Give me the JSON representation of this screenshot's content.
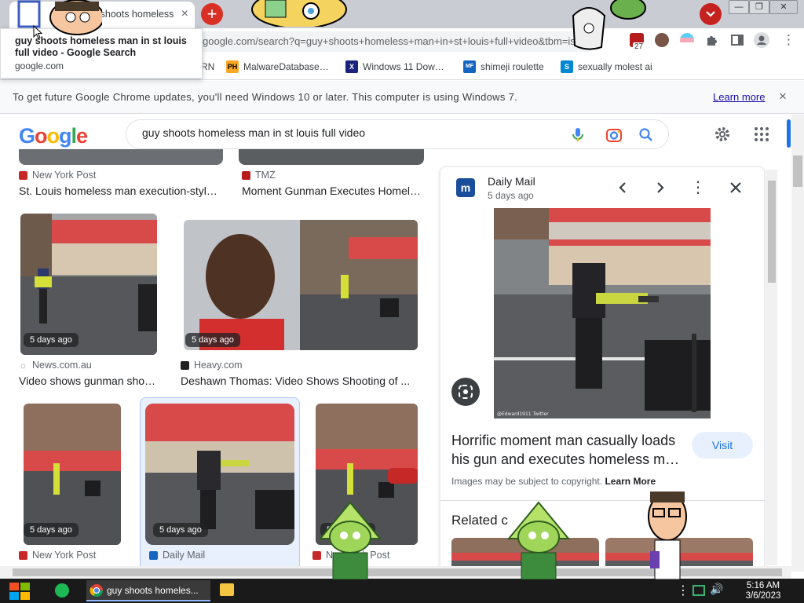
{
  "browser": {
    "tab_title": "guy shoots homeless man in st louis full video - Google Search",
    "url": "google.com/search?q=guy+shoots+homeless+man+in+st+louis+full+video&tbm=isch&so…",
    "new_tab_label": "+",
    "tab_close": "×",
    "extension_badge": "27",
    "tooltip": {
      "title": "guy shoots homeless man in st louis full video - Google Search",
      "domain": "google.com"
    },
    "bookmarks": [
      {
        "label": "RN"
      },
      {
        "label": "MalwareDatabase…",
        "icon": "PH"
      },
      {
        "label": "Windows 11 Dow…",
        "icon": "X"
      },
      {
        "label": "shimeji roulette",
        "icon": "MF"
      },
      {
        "label": "sexually molest ai",
        "icon": "S"
      }
    ],
    "infobar": {
      "message": "To get future Google Chrome updates, you'll need Windows 10 or later. This computer is using Windows 7.",
      "link": "Learn more",
      "close": "×"
    }
  },
  "google": {
    "logo": [
      "G",
      "o",
      "o",
      "g",
      "l",
      "e"
    ],
    "logo_colors": [
      "#4285F4",
      "#EA4335",
      "#FBBC05",
      "#4285F4",
      "#34A853",
      "#EA4335"
    ],
    "query": "guy shoots homeless man in st louis full video"
  },
  "results": [
    {
      "source": "New York Post",
      "caption": "St. Louis homeless man execution-styl…",
      "fav": "#c62828"
    },
    {
      "source": "TMZ",
      "caption": "Moment Gunman Executes Homel…",
      "fav": "#b71c1c"
    },
    {
      "source": "News.com.au",
      "caption": "Video shows gunman sho…",
      "badge": "5 days ago",
      "fav": "#9e9e9e"
    },
    {
      "source": "Heavy.com",
      "caption": "Deshawn Thomas: Video Shows Shooting of ...",
      "badge": "5 days ago",
      "fav": "#212121"
    },
    {
      "source": "New York Post",
      "badge": "5 days ago",
      "fav": "#c62828"
    },
    {
      "source": "Daily Mail",
      "badge": "5 days ago",
      "fav": "#1565c0"
    },
    {
      "source": "New York Post",
      "badge": "5 days ago",
      "fav": "#c62828"
    }
  ],
  "preview": {
    "source": "Daily Mail",
    "date": "5 days ago",
    "title": "Horrific moment man casually loads his gun and executes homeless m…",
    "visit": "Visit",
    "copyright": "Images may be subject to copyright.",
    "learn_more": "Learn More",
    "related": "Related c",
    "watermark": "@Edward1911.Twitter"
  },
  "taskbar": {
    "chrome_label": "guy shoots homeles...",
    "time": "5:16 AM",
    "date": "3/6/2023"
  }
}
